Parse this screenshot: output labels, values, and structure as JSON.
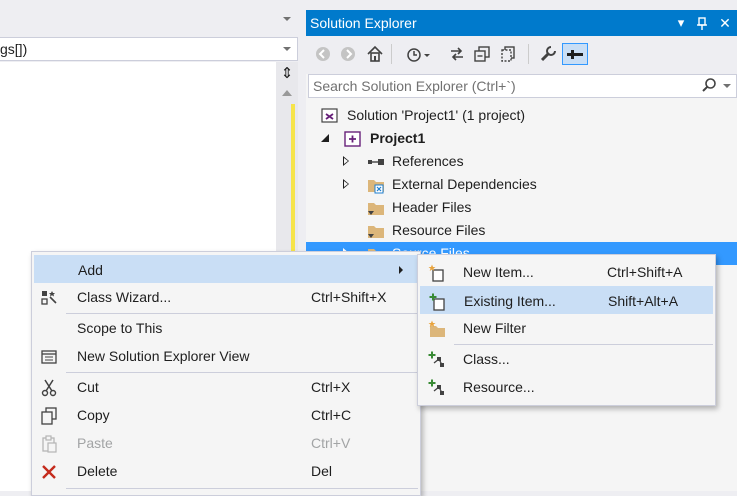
{
  "editor": {
    "combo_text": "gs[])"
  },
  "solution_explorer": {
    "title": "Solution Explorer",
    "search_placeholder": "Search Solution Explorer (Ctrl+`)",
    "tree": [
      {
        "label": "Solution 'Project1' (1 project)"
      },
      {
        "label": "Project1"
      },
      {
        "label": "References"
      },
      {
        "label": "External Dependencies"
      },
      {
        "label": "Header Files"
      },
      {
        "label": "Resource Files"
      },
      {
        "label": "Source Files"
      }
    ]
  },
  "context_menu": {
    "items": [
      {
        "label": "Add",
        "shortcut": "",
        "icon": "none"
      },
      {
        "label": "Class Wizard...",
        "shortcut": "Ctrl+Shift+X",
        "icon": "class-wizard-icon"
      },
      {
        "label": "Scope to This",
        "shortcut": "",
        "icon": "none"
      },
      {
        "label": "New Solution Explorer View",
        "shortcut": "",
        "icon": "new-view-icon"
      },
      {
        "label": "Cut",
        "shortcut": "Ctrl+X",
        "icon": "scissors-icon"
      },
      {
        "label": "Copy",
        "shortcut": "Ctrl+C",
        "icon": "copy-icon"
      },
      {
        "label": "Paste",
        "shortcut": "Ctrl+V",
        "icon": "paste-icon",
        "disabled": true
      },
      {
        "label": "Delete",
        "shortcut": "Del",
        "icon": "delete-x-icon"
      }
    ]
  },
  "submenu": {
    "items": [
      {
        "label": "New Item...",
        "shortcut": "Ctrl+Shift+A",
        "icon": "new-item-icon"
      },
      {
        "label": "Existing Item...",
        "shortcut": "Shift+Alt+A",
        "icon": "existing-item-icon"
      },
      {
        "label": "New Filter",
        "shortcut": "",
        "icon": "folder-star-icon"
      },
      {
        "label": "Class...",
        "shortcut": "",
        "icon": "class-icon"
      },
      {
        "label": "Resource...",
        "shortcut": "",
        "icon": "resource-icon"
      }
    ]
  },
  "colors": {
    "accent": "#007acc",
    "selection": "#3399ff",
    "menu_highlight": "#c9def5",
    "menu_background": "#f5f5f5",
    "folder": "#dcb67a",
    "delete_red": "#c42b1c"
  }
}
